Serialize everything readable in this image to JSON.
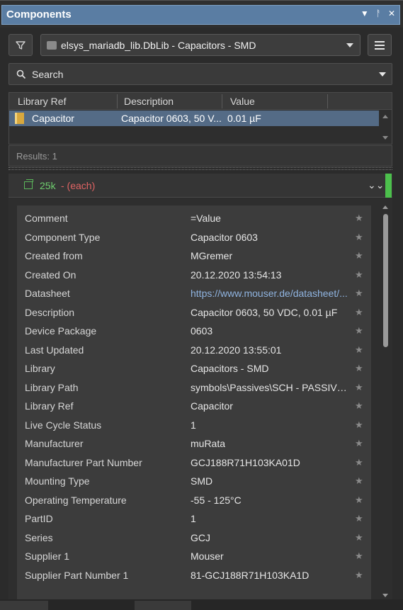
{
  "panel": {
    "title": "Components"
  },
  "toolbar": {
    "library": "elsys_mariadb_lib.DbLib - Capacitors - SMD"
  },
  "search": {
    "placeholder": "Search"
  },
  "table": {
    "headers": [
      "Library Ref",
      "Description",
      "Value"
    ],
    "row": {
      "ref": "Capacitor",
      "description": "Capacitor 0603, 50 V...",
      "value": "0.01 µF"
    }
  },
  "results": {
    "label": "Results: 1"
  },
  "supplier": {
    "stock": "25k",
    "each": "- (each)"
  },
  "properties": [
    {
      "name": "Comment",
      "value": "=Value"
    },
    {
      "name": "Component Type",
      "value": "Capacitor 0603"
    },
    {
      "name": "Created from",
      "value": "MGremer"
    },
    {
      "name": "Created On",
      "value": "20.12.2020 13:54:13"
    },
    {
      "name": "Datasheet",
      "value": "https://www.mouser.de/datasheet/..."
    },
    {
      "name": "Description",
      "value": "Capacitor 0603, 50 VDC, 0.01 µF"
    },
    {
      "name": "Device Package",
      "value": "0603"
    },
    {
      "name": "Last Updated",
      "value": "20.12.2020 13:55:01"
    },
    {
      "name": "Library",
      "value": "Capacitors - SMD"
    },
    {
      "name": "Library Path",
      "value": "symbols\\Passives\\SCH - PASSIVES -..."
    },
    {
      "name": "Library Ref",
      "value": "Capacitor"
    },
    {
      "name": "Live Cycle Status",
      "value": "1"
    },
    {
      "name": "Manufacturer",
      "value": "muRata"
    },
    {
      "name": "Manufacturer Part Number",
      "value": "GCJ188R71H103KA01D"
    },
    {
      "name": "Mounting Type",
      "value": "SMD"
    },
    {
      "name": "Operating Temperature",
      "value": "-55 - 125°C"
    },
    {
      "name": "PartID",
      "value": "1"
    },
    {
      "name": "Series",
      "value": "GCJ"
    },
    {
      "name": "Supplier 1",
      "value": "Mouser"
    },
    {
      "name": "Supplier Part Number 1",
      "value": "81-GCJ188R71H103KA1D"
    }
  ],
  "colors": {
    "titlebar": "#5a7da3",
    "selected_row": "#546b86",
    "stock": "#6fcf6f",
    "each": "#e06464",
    "status_bar": "#4cc04c",
    "link": "#8fb3df"
  }
}
